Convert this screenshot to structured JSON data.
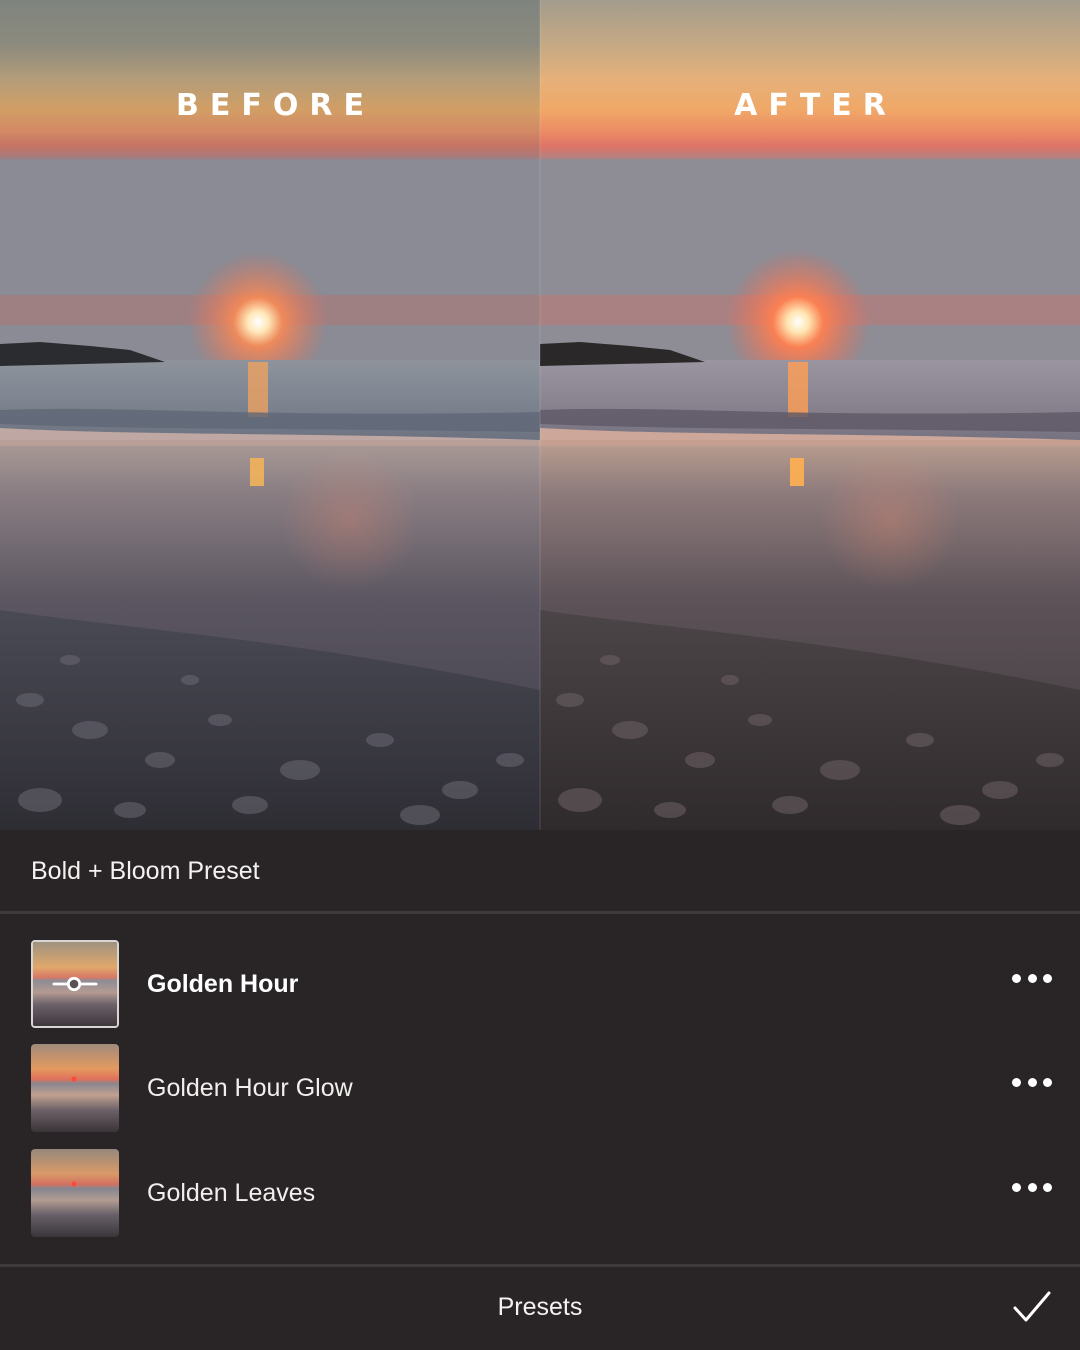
{
  "compare": {
    "before_label": "BEFORE",
    "after_label": "AFTER"
  },
  "preset_group": {
    "title": "Bold + Bloom Preset"
  },
  "presets": [
    {
      "name": "Golden Hour",
      "selected": true
    },
    {
      "name": "Golden Hour Glow",
      "selected": false
    },
    {
      "name": "Golden Leaves",
      "selected": false
    }
  ],
  "bottom_bar": {
    "title": "Presets"
  },
  "icons": {
    "more": "more-horizontal-icon",
    "confirm": "checkmark-icon",
    "adjust": "slider-adjust-icon"
  },
  "colors": {
    "background": "#292526",
    "text": "#f2f0ef",
    "separator": "#3f3b3c"
  }
}
